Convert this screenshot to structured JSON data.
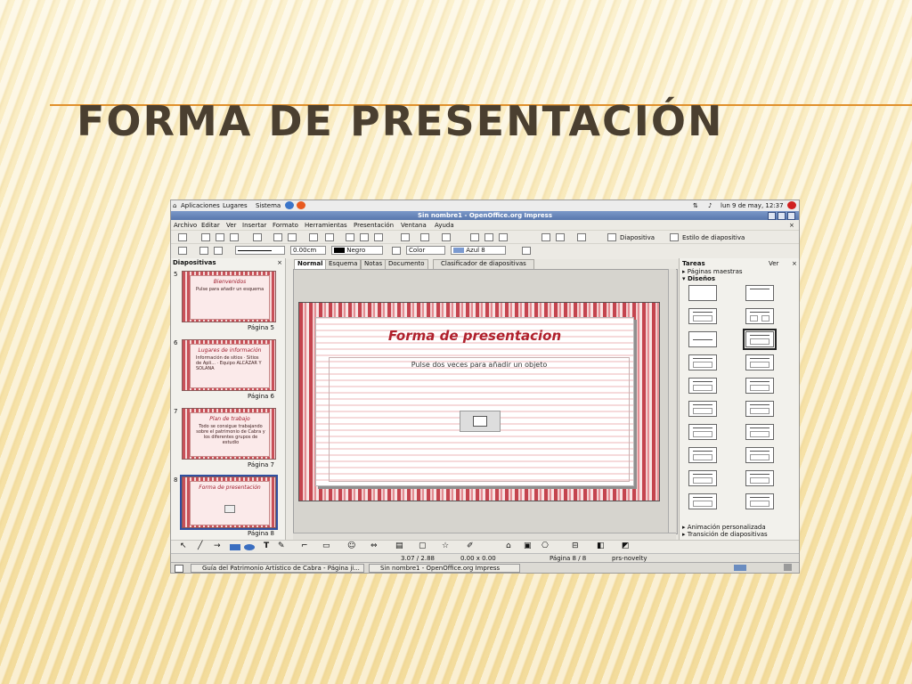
{
  "slide": {
    "title": "FORMA DE PRESENTACIÓN"
  },
  "system_bar": {
    "menus": [
      "Aplicaciones",
      "Lugares",
      "Sistema"
    ],
    "datetime": "lun 9 de may, 12:37"
  },
  "window": {
    "title": "Sin nombre1 - OpenOffice.org Impress"
  },
  "menu": [
    "Archivo",
    "Editar",
    "Ver",
    "Insertar",
    "Formato",
    "Herramientas",
    "Presentación",
    "Ventana",
    "Ayuda"
  ],
  "toolbar1": {
    "slide_button": "Diapositiva",
    "style_button": "Estilo de diapositiva"
  },
  "toolbar2": {
    "line_width": "0.00cm",
    "line_color": "Negro",
    "area_type": "Color",
    "area_color": "Azul 8"
  },
  "slides_panel": {
    "header": "Diapositivas",
    "slides": [
      {
        "number": "5",
        "title": "Bienvenidos",
        "text": "Pulse para añadir un esquema",
        "page": "Página 5"
      },
      {
        "number": "6",
        "title": "Lugares de información",
        "text": "Información de sitios · Sitios de Apli... · Equipo ALCÁZAR Y SOLANA",
        "page": "Página 6"
      },
      {
        "number": "7",
        "title": "Plan de trabajo",
        "text": "Todo se consigue trabajando sobre el patrimonio de Cabra y los diferentes grupos de estudio",
        "page": "Página 7"
      },
      {
        "number": "8",
        "title": "Forma de presentación",
        "text": "",
        "page": "Página 8"
      }
    ]
  },
  "view_tabs": [
    "Normal",
    "Esquema",
    "Notas",
    "Documento",
    "Clasificador de diapositivas"
  ],
  "current_slide": {
    "title": "Forma de presentacion",
    "object_hint": "Pulse dos veces para añadir un objeto"
  },
  "tasks_panel": {
    "header": "Tareas",
    "view_menu": "Ver",
    "sections": [
      "Páginas maestras",
      "Diseños"
    ],
    "footer_sections": [
      "Animación personalizada",
      "Transición de diapositivas"
    ]
  },
  "status": {
    "position": "3.07 / 2.88",
    "size": "0.00 x 0.00",
    "page": "Página 8 / 8",
    "master": "prs-novelty"
  },
  "taskbar": [
    "Guía del Patrimonio Artístico de Cabra - Página ji...",
    "Sin nombre1 - OpenOffice.org Impress"
  ]
}
